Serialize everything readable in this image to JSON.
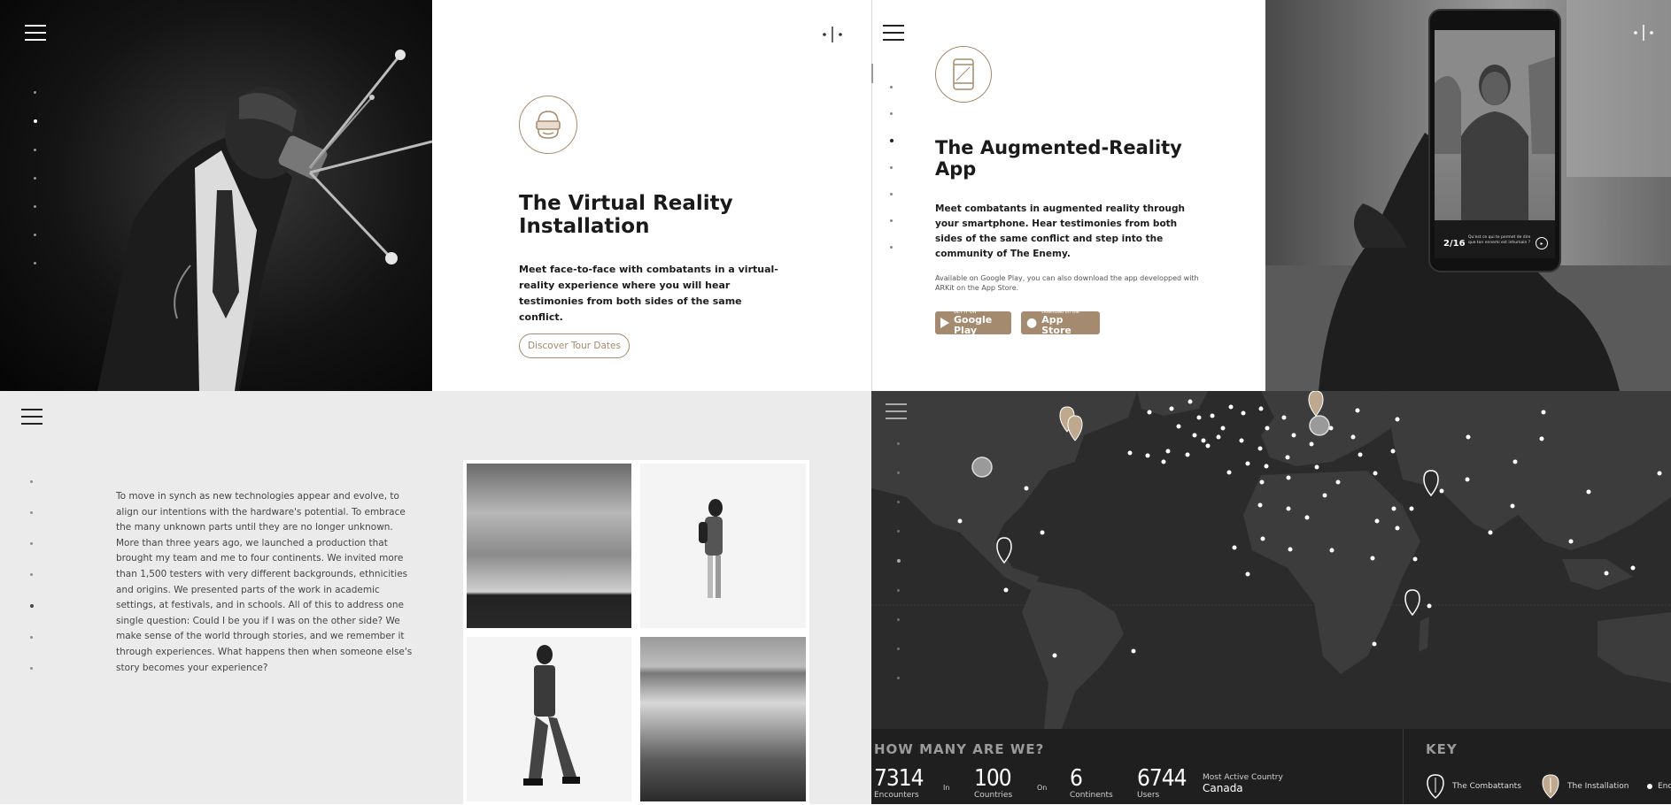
{
  "vr": {
    "title": "The Virtual Reality Installation",
    "body": "Meet face-to-face with combatants in a virtual-reality experience where you will hear testimonies from both sides of the same conflict.",
    "cta": "Discover Tour Dates",
    "logo_icon": "split-logo-icon"
  },
  "ar": {
    "title": "The Augmented-Reality App",
    "body": "Meet combatants in augmented reality through your smartphone. Hear testimonies from both sides of the same conflict and step into the community of The Enemy.",
    "note": "Available on Google Play, you can also download the app developped with ARKit on the App Store.",
    "google_small": "GET IT ON",
    "google_big": "Google Play",
    "apple_small": "Download on the",
    "apple_big": "App Store",
    "phone_counter": "2/16",
    "phone_caption": "Qu'est ce qui te permet de dire que ton ennemi est inhumain ?"
  },
  "story": {
    "text": "To move in synch as new technologies appear and evolve, to align our intentions with the hardware's potential. To embrace the many unknown parts until they are no longer unknown. More than three years ago, we launched a production that brought my team and me to four continents. We invited more than 1,500 testers with very different backgrounds, ethnicities and origins. We presented parts of the work in academic settings, at festivals, and in schools. All of this to address one single question: Could I be you if I was on the other side? We make sense of the world through stories, and we remember it through experiences. What happens then when someone else's story becomes your experience?"
  },
  "map": {
    "heading": "HOW MANY ARE WE?",
    "stats": [
      {
        "num": "7314",
        "label": "Encounters"
      },
      {
        "num": "100",
        "label": "Countries"
      },
      {
        "num": "6",
        "label": "Continents"
      },
      {
        "num": "6744",
        "label": "Users"
      }
    ],
    "in_word": "In",
    "on_word": "On",
    "most_active_label": "Most Active Country",
    "most_active_value": "Canada",
    "key_heading": "KEY",
    "key_items": [
      "The Combattants",
      "The Installation",
      "Encounters"
    ]
  },
  "colors": {
    "accent": "#a48a6e",
    "map_bg": "#2b2b2b",
    "panel_grey": "#ebebeb"
  }
}
